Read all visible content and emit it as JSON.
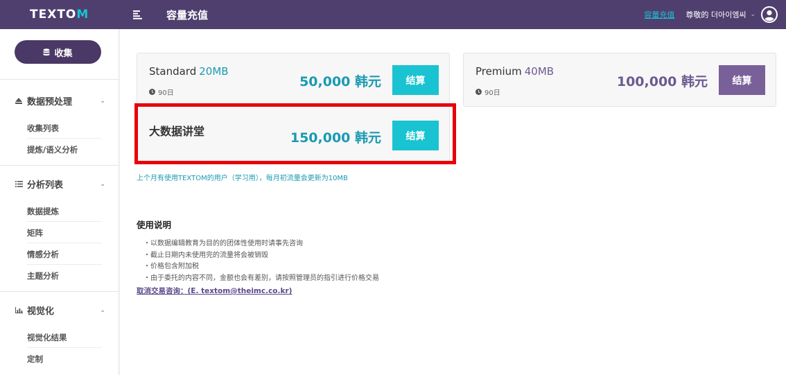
{
  "header": {
    "logo_main": "TEXTO",
    "logo_accent": "M",
    "page_title": "容量充值",
    "recharge_link": "容量充值",
    "user_greeting": "尊敬的 더아이엠씨",
    "user_chevron": "⌄",
    "colors": {
      "bar": "#4f3f6e",
      "accent": "#19c3d1"
    }
  },
  "sidebar": {
    "collect_button": "收集",
    "sections": [
      {
        "label": "数据预处理",
        "icon": "upload-triangle-icon",
        "items": [
          "收集列表",
          "提炼/语义分析"
        ]
      },
      {
        "label": "分析列表",
        "icon": "list-icon",
        "items": [
          "数据提炼",
          "矩阵",
          "情感分析",
          "主题分析"
        ]
      },
      {
        "label": "视觉化",
        "icon": "bar-chart-icon",
        "items": [
          "视觉化结果",
          "定制"
        ]
      }
    ],
    "chevron": "⌄"
  },
  "plans": {
    "standard": {
      "name": "Standard",
      "size": "20MB",
      "days": "90日",
      "price": "50,000 韩元",
      "button": "结算"
    },
    "premium": {
      "name": "Premium",
      "size": "40MB",
      "days": "90日",
      "price": "100,000 韩元",
      "button": "结算"
    },
    "bigdata": {
      "name": "大数据讲堂",
      "price": "150,000 韩元",
      "button": "结算"
    }
  },
  "notice": "上个月有使用TEXTOM的用户（学习用），每月初流量会更新为10MB",
  "usage": {
    "title": "使用说明",
    "items": [
      "・以数据编辑教育为目的的团体性使用时请事先咨询",
      "・截止日期内未使用完的流量将会被销毁",
      "・价格包含附加税",
      "・由于委托的内容不同，金额也会有差别，请按照管理员的指引进行价格交易"
    ],
    "cancel_link": "取消交易咨询：(E. textom@theimc.co.kr)"
  },
  "colors": {
    "teal": "#1a9ab1",
    "teal_button": "#19c3d1",
    "purple": "#6c5a8f",
    "purple_button": "#7a6099",
    "highlight": "#e8000a"
  }
}
